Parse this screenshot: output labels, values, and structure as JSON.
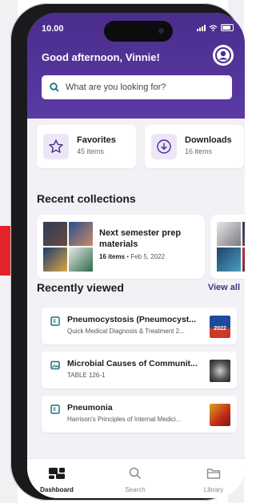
{
  "status": {
    "time": "10.00"
  },
  "header": {
    "greeting": "Good afternoon, Vinnie!",
    "search_placeholder": "What are you looking for?"
  },
  "quick_links": [
    {
      "title": "Favorites",
      "count": "45 items",
      "icon": "star-icon"
    },
    {
      "title": "Downloads",
      "count": "16 items",
      "icon": "download-icon"
    }
  ],
  "recent_collections": {
    "title": "Recent collections",
    "items": [
      {
        "title": "Next semester prep materials",
        "count": "16 items",
        "separator": "•",
        "date": "Feb 5, 2022"
      }
    ]
  },
  "recently_viewed": {
    "title": "Recently viewed",
    "view_all": "View all",
    "items": [
      {
        "title": "Pneumocystosis (Pneumocyst...",
        "subtitle": "Quick Medical Diagnosis & Treatment 2...",
        "icon": "document-icon",
        "thumb_label": "2022"
      },
      {
        "title": "Microbial Causes of Communit...",
        "subtitle": "TABLE 126-1",
        "icon": "image-icon"
      },
      {
        "title": "Pneumonia",
        "subtitle": "Harrison's Principles of Internal Medici...",
        "icon": "document-icon"
      }
    ]
  },
  "tabs": [
    {
      "label": "Dashboard",
      "icon": "dashboard-icon",
      "active": true
    },
    {
      "label": "Search",
      "icon": "search-icon",
      "active": false
    },
    {
      "label": "Library",
      "icon": "folder-icon",
      "active": false
    }
  ],
  "colors": {
    "brand_purple": "#4a2d8c",
    "accent_teal": "#1f6f82",
    "tile_bg": "#ece6f7"
  }
}
